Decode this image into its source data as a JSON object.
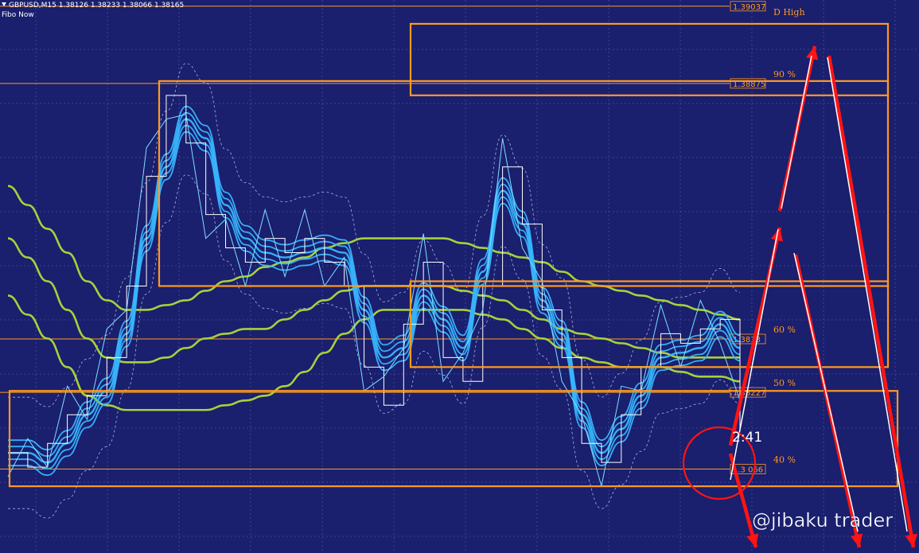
{
  "header": {
    "symbol_line": "GBPUSD,M15  1.38126 1.38233 1.38066 1.38165",
    "indicator": "Fibo Now"
  },
  "colors": {
    "background": "#1a1f6e",
    "grid": "#5a62b5",
    "fibo": "#ff9a1f",
    "ma_slow": "#a6d13a",
    "band": "#38b6ff",
    "price": "#ffffff",
    "arrow": "#ff1414",
    "envelope": "#cfd6ff"
  },
  "chart_data": {
    "type": "line",
    "symbol": "GBPUSD",
    "timeframe": "M15",
    "ohlc": {
      "open": 1.38126,
      "high": 1.38233,
      "low": 1.38066,
      "close": 1.38165
    },
    "ylim": [
      1.3789,
      1.3905
    ],
    "fibo_levels": [
      {
        "price": 1.39037,
        "price_label": "1.39037",
        "level_label": "D High"
      },
      {
        "price": 1.38875,
        "price_label": "1.38875",
        "level_label": "90 %"
      },
      {
        "price": 1.38339,
        "price_label": "1.3833",
        "level_label": "60 %"
      },
      {
        "price": 1.38227,
        "price_label": "1.38227",
        "level_label": "50 %"
      },
      {
        "price": 1.38066,
        "price_label": "1.3 066",
        "level_label": "40 %"
      }
    ],
    "timer": "2:41",
    "zones": [
      {
        "name": "zone-d-high",
        "from": 1.3885,
        "to": 1.39
      },
      {
        "name": "zone-upper",
        "from": 1.3845,
        "to": 1.3888
      },
      {
        "name": "zone-middle",
        "from": 1.3828,
        "to": 1.3846
      },
      {
        "name": "zone-lower",
        "from": 1.3803,
        "to": 1.3823
      }
    ],
    "series": [
      {
        "key": "ma_slow",
        "values": [
          1.3866,
          1.3862,
          1.3857,
          1.3852,
          1.3846,
          1.3842,
          1.384,
          1.384,
          1.3841,
          1.3842,
          1.3844,
          1.3846,
          1.3847,
          1.3849,
          1.385,
          1.3851,
          1.3853,
          1.3854,
          1.3855,
          1.3855,
          1.3855,
          1.3855,
          1.3855,
          1.3854,
          1.3853,
          1.3852,
          1.3851,
          1.385,
          1.3848,
          1.3846,
          1.3845,
          1.3844,
          1.3843,
          1.3842,
          1.3841,
          1.384,
          1.3839,
          1.3838
        ]
      },
      {
        "key": "ma_mid",
        "values": [
          1.3855,
          1.3851,
          1.3846,
          1.384,
          1.3834,
          1.383,
          1.3829,
          1.3829,
          1.383,
          1.3832,
          1.3834,
          1.3835,
          1.3836,
          1.3836,
          1.3838,
          1.384,
          1.3842,
          1.3844,
          1.3845,
          1.3845,
          1.3845,
          1.3845,
          1.3845,
          1.3844,
          1.3843,
          1.3842,
          1.384,
          1.3838,
          1.3836,
          1.3835,
          1.3834,
          1.3833,
          1.3832,
          1.3831,
          1.383,
          1.383,
          1.383,
          1.383
        ]
      },
      {
        "key": "ma_fast",
        "values": [
          1.3843,
          1.3839,
          1.3834,
          1.3828,
          1.3822,
          1.382,
          1.3819,
          1.3819,
          1.3819,
          1.3819,
          1.3819,
          1.382,
          1.3821,
          1.3822,
          1.3824,
          1.3827,
          1.3831,
          1.3835,
          1.3838,
          1.384,
          1.384,
          1.384,
          1.384,
          1.384,
          1.3839,
          1.3838,
          1.3836,
          1.3834,
          1.3832,
          1.383,
          1.3829,
          1.3828,
          1.3828,
          1.3828,
          1.3827,
          1.3826,
          1.3826,
          1.3825
        ]
      },
      {
        "key": "band_mid",
        "values": [
          1.381,
          1.381,
          1.3808,
          1.3812,
          1.3818,
          1.3823,
          1.3835,
          1.3855,
          1.387,
          1.388,
          1.3876,
          1.3862,
          1.3855,
          1.3852,
          1.3851,
          1.3852,
          1.3853,
          1.3852,
          1.384,
          1.383,
          1.3832,
          1.3843,
          1.3838,
          1.3832,
          1.3848,
          1.3865,
          1.3858,
          1.3842,
          1.3835,
          1.3818,
          1.381,
          1.3815,
          1.3822,
          1.383,
          1.3831,
          1.3832,
          1.3837,
          1.3832
        ]
      },
      {
        "key": "price",
        "values": [
          1.381,
          1.3807,
          1.3812,
          1.3818,
          1.3822,
          1.383,
          1.3845,
          1.3868,
          1.3885,
          1.3875,
          1.386,
          1.3853,
          1.385,
          1.3855,
          1.3852,
          1.3855,
          1.385,
          1.3845,
          1.3828,
          1.382,
          1.3837,
          1.385,
          1.383,
          1.3825,
          1.3845,
          1.387,
          1.3858,
          1.384,
          1.383,
          1.3812,
          1.3808,
          1.3818,
          1.3828,
          1.3835,
          1.3833,
          1.3836,
          1.3838,
          1.3815
        ]
      }
    ]
  },
  "watermark": "@jibaku trader"
}
